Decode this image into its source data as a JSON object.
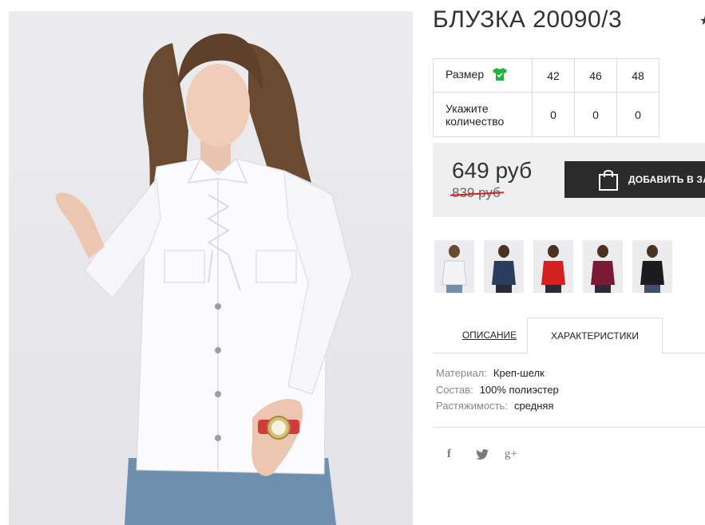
{
  "product": {
    "title": "БЛУЗКА 20090/3",
    "main_image_alt": "Женщина в белой блузке со шнуровкой"
  },
  "sizes": {
    "size_label": "Размер",
    "qty_label_line1": "Укажите",
    "qty_label_line2": "количество",
    "options": [
      "42",
      "46",
      "48"
    ],
    "quantities": [
      "0",
      "0",
      "0"
    ],
    "icon": "shirt-icon",
    "icon_color": "#1fb53c"
  },
  "price": {
    "current": "649 руб",
    "old": "839 руб",
    "strike_color": "#e02020"
  },
  "cart_button": {
    "label": "ДОБАВИТЬ В ЗА",
    "icon": "shopping-bag-icon",
    "bg_color": "#2b2b2b"
  },
  "thumbnails": [
    {
      "color_name": "white",
      "color": "#f4f4f6"
    },
    {
      "color_name": "navy",
      "color": "#2a3d5c"
    },
    {
      "color_name": "red",
      "color": "#d42020"
    },
    {
      "color_name": "burgundy",
      "color": "#7a1a33"
    },
    {
      "color_name": "black",
      "color": "#1c1c1e"
    }
  ],
  "tabs": {
    "description": "ОПИСАНИЕ",
    "characteristics": "ХАРАКТЕРИСТИКИ",
    "active": "characteristics"
  },
  "characteristics": [
    {
      "key": "Материал:",
      "value": "Креп-шелк"
    },
    {
      "key": "Состав:",
      "value": "100% полиэстер"
    },
    {
      "key": "Растяжимость:",
      "value": "средняя"
    }
  ],
  "social": {
    "facebook": "f",
    "twitter": "twitter-icon",
    "googleplus": "g+"
  }
}
